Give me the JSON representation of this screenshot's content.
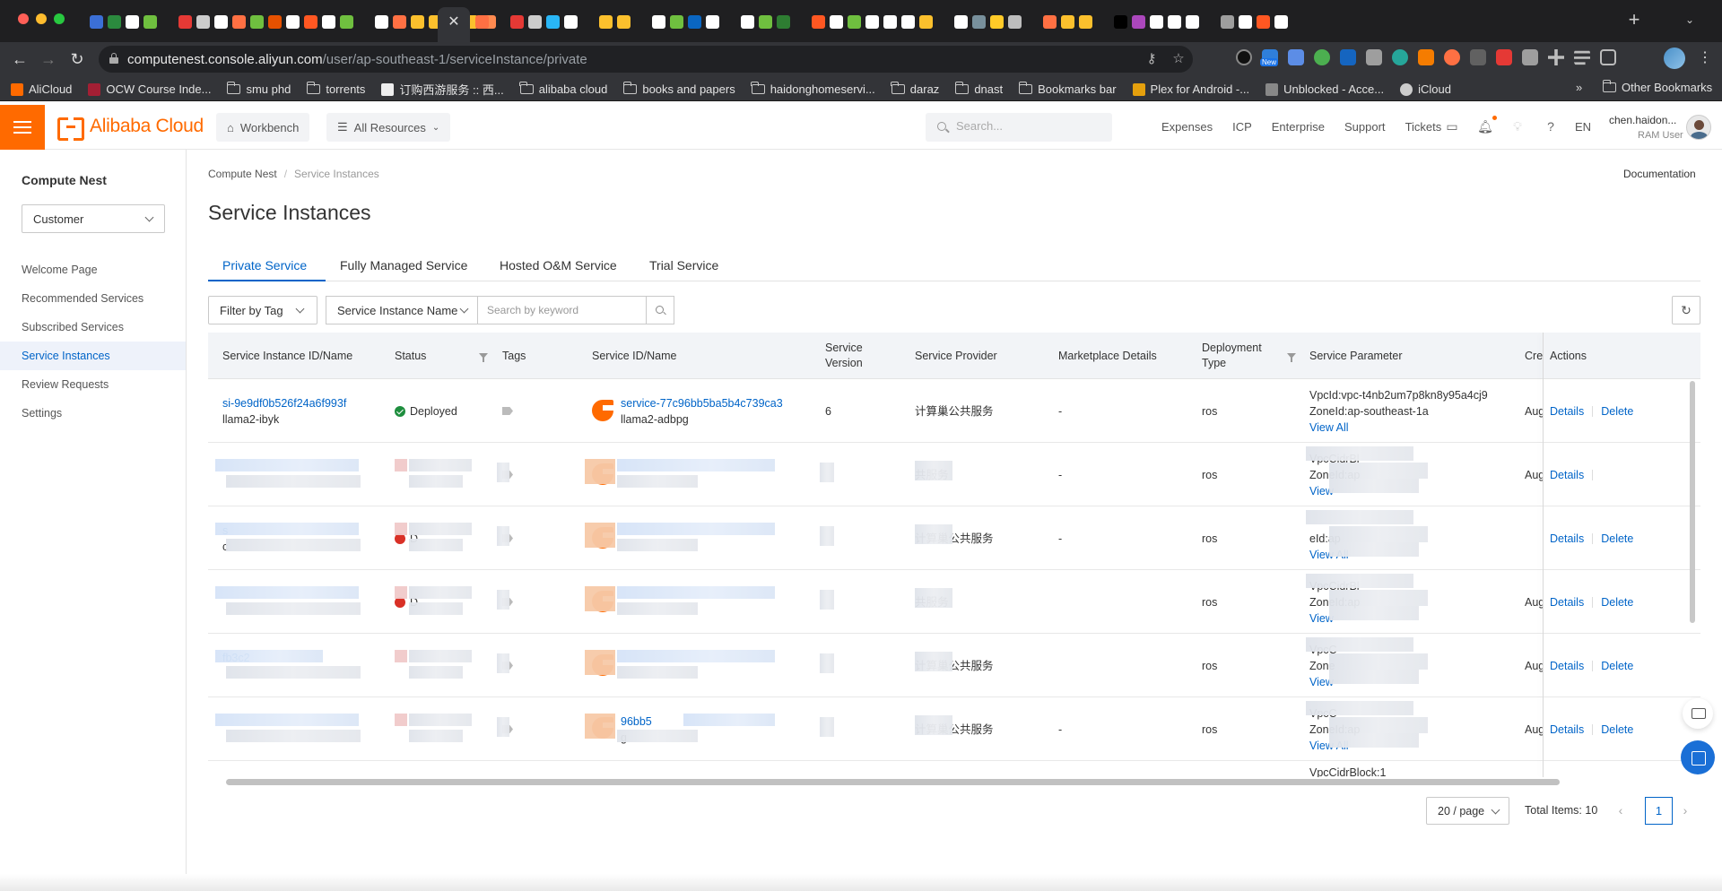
{
  "browser": {
    "url_host": "computenest.console.aliyun.com",
    "url_path": "/user/ap-southeast-1/serviceInstance/private",
    "new_badge": "New",
    "bookmarks": [
      {
        "label": "AliCloud",
        "icon": "alicloud-icon",
        "color": "#ff6a00"
      },
      {
        "label": "OCW Course Inde...",
        "icon": "mit-icon",
        "color": "#a31f34"
      },
      {
        "label": "smu phd",
        "icon": "folder-icon"
      },
      {
        "label": "torrents",
        "icon": "folder-icon"
      },
      {
        "label": "订购西游服务 :: 西...",
        "icon": "site-icon",
        "color": "#eeeeee"
      },
      {
        "label": "alibaba cloud",
        "icon": "folder-icon"
      },
      {
        "label": "books and papers",
        "icon": "folder-icon"
      },
      {
        "label": "haidonghomeservi...",
        "icon": "folder-icon"
      },
      {
        "label": "daraz",
        "icon": "folder-icon"
      },
      {
        "label": "dnast",
        "icon": "folder-icon"
      },
      {
        "label": "Bookmarks bar",
        "icon": "folder-icon"
      },
      {
        "label": "Plex for Android -...",
        "icon": "plex-icon",
        "color": "#e5a00d"
      },
      {
        "label": "Unblocked - Acce...",
        "icon": "site-icon",
        "color": "#888888"
      },
      {
        "label": "iCloud",
        "icon": "apple-icon",
        "color": "#cccccc"
      }
    ],
    "bookmarks_overflow": "»",
    "other_bookmarks": "Other Bookmarks"
  },
  "header": {
    "logo_text": "Alibaba Cloud",
    "workbench": "Workbench",
    "all_resources": "All Resources",
    "search_placeholder": "Search...",
    "links": [
      "Expenses",
      "ICP",
      "Enterprise",
      "Support",
      "Tickets"
    ],
    "lang": "EN",
    "user_name": "chen.haidon...",
    "user_role": "RAM User"
  },
  "sidebar": {
    "title": "Compute Nest",
    "role_select": "Customer",
    "items": [
      {
        "label": "Welcome Page",
        "active": false
      },
      {
        "label": "Recommended Services",
        "active": false
      },
      {
        "label": "Subscribed Services",
        "active": false
      },
      {
        "label": "Service Instances",
        "active": true
      },
      {
        "label": "Review Requests",
        "active": false
      },
      {
        "label": "Settings",
        "active": false
      }
    ]
  },
  "main": {
    "breadcrumb": [
      "Compute Nest",
      "Service Instances"
    ],
    "documentation": "Documentation",
    "title": "Service Instances",
    "tabs": [
      "Private Service",
      "Fully Managed Service",
      "Hosted O&M Service",
      "Trial Service"
    ],
    "filter_tag": "Filter by Tag",
    "filter_field": "Service Instance Name",
    "keyword_placeholder": "Search by keyword"
  },
  "table": {
    "columns": [
      "Service Instance ID/Name",
      "Status",
      "Tags",
      "Service ID/Name",
      "Service Version",
      "Service Provider",
      "Marketplace Details",
      "Deployment Type",
      "Service Parameter",
      "Cre",
      "Actions"
    ],
    "rows": [
      {
        "instance_id": "si-9e9df0b526f24a6f993f",
        "instance_name": "llama2-ibyk",
        "status": "Deployed",
        "service_id": "service-77c96bb5ba5b4c739ca3",
        "service_name": "llama2-adbpg",
        "version": "6",
        "provider": "计算巢公共服务",
        "marketplace": "-",
        "deployment": "ros",
        "param_line1": "VpcId:vpc-t4nb2um7p8kn8y95a4cj9",
        "param_line2": "ZoneId:ap-southeast-1a",
        "view_all": "View All",
        "created": "Aug",
        "details": "Details",
        "delete": "Delete"
      },
      {
        "instance_id": "",
        "instance_name": "",
        "status": "",
        "service_id": "",
        "service_name": "",
        "version": "",
        "provider": "共服务",
        "marketplace": "-",
        "deployment": "ros",
        "param_line1": "VpcCidrBl",
        "param_line2": "ZoneId:ap",
        "view_all": "View",
        "created": "Aug",
        "details": "Details",
        "delete": ""
      },
      {
        "instance_id": "s",
        "instance_name": "c",
        "status": "D",
        "service_id": "",
        "service_name": "",
        "version": "",
        "provider": "计算巢公共服务",
        "marketplace": "-",
        "deployment": "ros",
        "param_line1": "",
        "param_line2": "eId:ap",
        "view_all": "View All",
        "created": "",
        "details": "Details",
        "delete": "Delete"
      },
      {
        "instance_id": "",
        "instance_name": "",
        "status": "D",
        "service_id": "",
        "service_name": "",
        "version": "",
        "provider": "共服务",
        "marketplace": "",
        "deployment": "ros",
        "param_line1": "VpcCidrBl",
        "param_line2": "ZoneId:ap",
        "view_all": "View",
        "created": "Aug",
        "details": "Details",
        "delete": "Delete"
      },
      {
        "instance_id": "fb3c2",
        "instance_name": "",
        "status": "",
        "service_id": "",
        "service_name": "",
        "version": "",
        "provider": "计算巢公共服务",
        "marketplace": "",
        "deployment": "ros",
        "param_line1": "VpcC",
        "param_line2": "Zone",
        "view_all": "View",
        "created": "Aug",
        "details": "Details",
        "delete": "Delete"
      },
      {
        "instance_id": "",
        "instance_name": "",
        "status": "",
        "service_id": "96bb5",
        "service_name": "g",
        "version": "",
        "provider": "计算巢公共服务",
        "marketplace": "-",
        "deployment": "ros",
        "param_line1": "VpcC",
        "param_line2": "ZoneId:ap",
        "view_all": "View All",
        "created": "Aug",
        "details": "Details",
        "delete": "Delete"
      }
    ],
    "partial_row_param": "VpcCidrBlock:1"
  },
  "pagination": {
    "page_size": "20 / page",
    "total": "Total Items: 10",
    "current": "1"
  },
  "colors": {
    "accent": "#0064c8",
    "brand": "#ff6a00",
    "success": "#1e8e3e",
    "error": "#d93026"
  }
}
